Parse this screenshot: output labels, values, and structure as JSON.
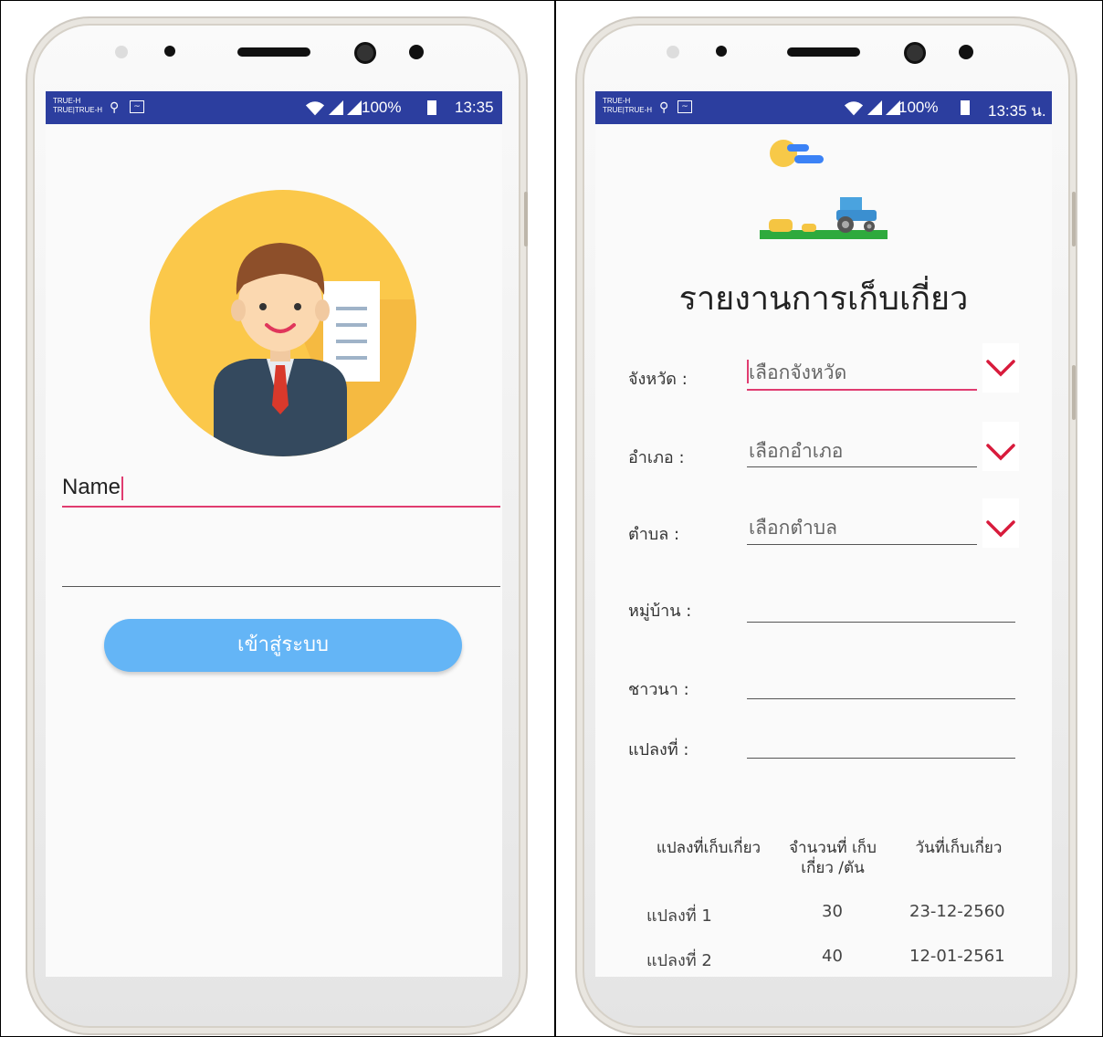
{
  "status_bar": {
    "carrier_line1": "TRUE-H",
    "carrier_line2": "TRUE|TRUE-H",
    "battery": "100%",
    "time_left": "13:35",
    "time_right": "13:35 น."
  },
  "login_screen": {
    "name_input": "Name",
    "login_button": "เข้าสู่ระบบ"
  },
  "harvest_screen": {
    "title": "รายงานการเก็บเกี่ยว",
    "fields": [
      {
        "label": "จังหวัด :",
        "value": "เลือกจังหวัด"
      },
      {
        "label": "อำเภอ :",
        "value": "เลือกอำเภอ"
      },
      {
        "label": "ตำบล :",
        "value": "เลือกตำบล"
      },
      {
        "label": "หมู่บ้าน :",
        "value": ""
      },
      {
        "label": "ชาวนา :",
        "value": ""
      },
      {
        "label": "แปลงที่ :",
        "value": ""
      }
    ],
    "table": {
      "headers": [
        "แปลงที่เก็บเกี่ยว",
        "จำนวนที่ เก็บ เกี่ยว /ตัน",
        "วันที่เก็บเกี่ยว"
      ],
      "rows": [
        [
          "แปลงที่ 1",
          "30",
          "23-12-2560"
        ],
        [
          "แปลงที่ 2",
          "40",
          "12-01-2561"
        ]
      ]
    }
  },
  "colors": {
    "status_bar": "#2c3e9f",
    "accent_pink": "#e03c70",
    "button_blue": "#64b5f6",
    "dropdown_red": "#d81b3c",
    "avatar_bg": "#fbc84a"
  }
}
